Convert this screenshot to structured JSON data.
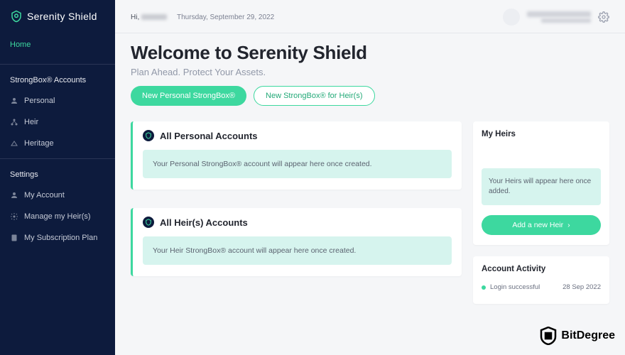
{
  "brand": {
    "name": "Serenity Shield"
  },
  "sidebar": {
    "home": "Home",
    "accounts_heading": "StrongBox® Accounts",
    "items": [
      {
        "label": "Personal"
      },
      {
        "label": "Heir"
      },
      {
        "label": "Heritage"
      }
    ],
    "settings_heading": "Settings",
    "settings_items": [
      {
        "label": "My Account"
      },
      {
        "label": "Manage my Heir(s)"
      },
      {
        "label": "My Subscription Plan"
      }
    ]
  },
  "topbar": {
    "greeting_prefix": "Hi,",
    "date": "Thursday, September 29, 2022"
  },
  "page": {
    "title": "Welcome to Serenity Shield",
    "subtitle": "Plan Ahead. Protect Your Assets."
  },
  "cta": {
    "new_personal": "New Personal StrongBox®",
    "new_heir": "New StrongBox® for Heir(s)"
  },
  "panels": {
    "personal": {
      "title": "All Personal Accounts",
      "empty": "Your Personal StrongBox® account will appear here once created."
    },
    "heir": {
      "title": "All Heir(s) Accounts",
      "empty": "Your Heir StrongBox® account will appear here once created."
    }
  },
  "heirs": {
    "title": "My Heirs",
    "empty": "Your Heirs will appear here once added.",
    "add_button": "Add a new Heir"
  },
  "activity": {
    "title": "Account Activity",
    "rows": [
      {
        "label": "Login successful",
        "date": "28 Sep 2022"
      }
    ]
  },
  "watermark": "BitDegree"
}
